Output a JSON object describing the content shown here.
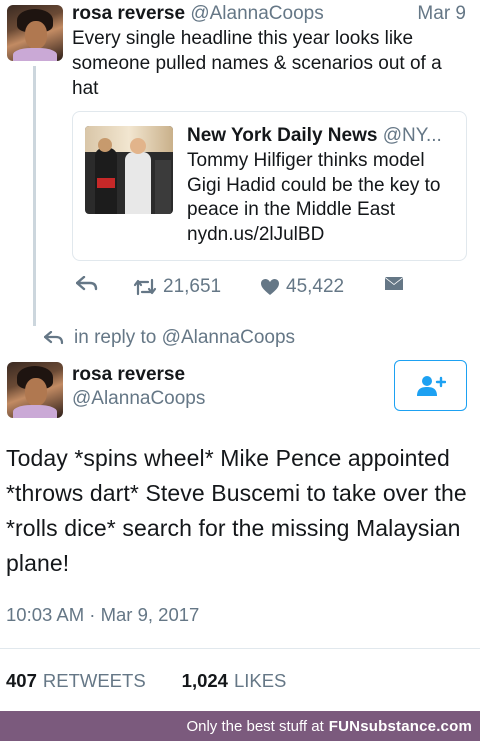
{
  "tweet1": {
    "name": "rosa reverse",
    "handle": "@AlannaCoops",
    "date": "Mar 9",
    "text": "Every single headline this year looks like someone pulled names & scenarios out of a hat",
    "quote": {
      "source": "New York Daily News",
      "handle": "@NY...",
      "text": "Tommy Hilfiger thinks model Gigi Hadid could be the key to peace in the Middle East",
      "link": "nydn.us/2lJulBD"
    },
    "retweets": "21,651",
    "likes": "45,422"
  },
  "reply_to": "in reply to @AlannaCoops",
  "tweet2": {
    "name": "rosa reverse",
    "handle": "@AlannaCoops",
    "text": "Today *spins wheel* Mike Pence appointed *throws dart* Steve Buscemi to take over the *rolls dice* search for the missing Malaysian plane!",
    "timestamp": "10:03 AM · Mar 9, 2017",
    "retweets_count": "407",
    "retweets_label": "RETWEETS",
    "likes_count": "1,024",
    "likes_label": "LIKES"
  },
  "footer": {
    "text": "Only the best stuff at",
    "brand": "FUNsubstance.com"
  },
  "colors": {
    "accent": "#1da1f2",
    "muted": "#657786",
    "footer_bg": "#7b5a7d"
  }
}
